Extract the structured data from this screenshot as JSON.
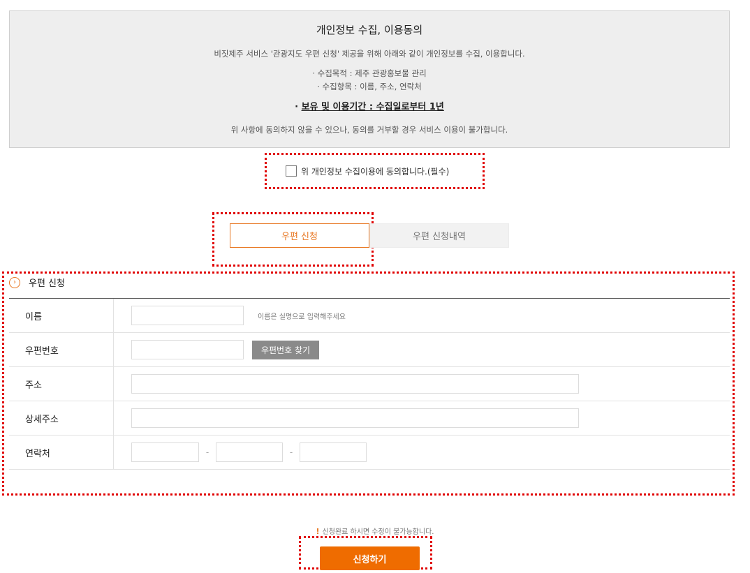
{
  "consent": {
    "title": "개인정보 수집, 이용동의",
    "intro": "비짓제주 서비스 '관광지도 우편 신청' 제공을 위해 아래와 같이 개인정보를 수집, 이용합니다.",
    "item_purpose": "· 수집목적 : 제주 관광홍보물 관리",
    "item_fields": "· 수집항목 : 이름, 주소, 연락처",
    "retention_prefix": "· ",
    "retention": "보유 및 이용기간 : 수집일로부터 1년",
    "note": "위 사항에 동의하지 않을 수 있으나, 동의를 거부할 경우 서비스 이용이 불가합니다."
  },
  "agree": {
    "label": "위 개인정보 수집이용에 동의합니다.(필수)",
    "checked": false
  },
  "tabs": [
    {
      "label": "우편 신청",
      "active": true
    },
    {
      "label": "우편 신청내역",
      "active": false
    }
  ],
  "section": {
    "icon": "chevron-circle-icon",
    "title": "우편 신청"
  },
  "form": {
    "name_label": "이름",
    "name_value": "",
    "name_hint": "이름은 실명으로 입력해주세요",
    "zip_label": "우편번호",
    "zip_value": "",
    "zip_button": "우편번호 찾기",
    "address_label": "주소",
    "address_value": "",
    "detail_label": "상세주소",
    "detail_value": "",
    "phone_label": "연락처",
    "phone1": "",
    "phone2": "",
    "phone3": "",
    "phone_sep": "-"
  },
  "footer": {
    "notice": "신청완료 하시면 수정이 불가능합니다.",
    "warn_icon": "!",
    "submit": "신청하기"
  },
  "colors": {
    "accent": "#e87722",
    "submit_bg": "#ef6c00",
    "highlight": "#e00000"
  }
}
